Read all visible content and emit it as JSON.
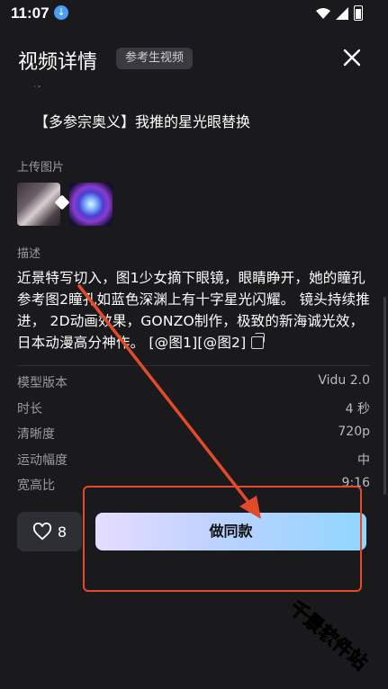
{
  "status": {
    "time": "11:07"
  },
  "header": {
    "title": "视频详情",
    "badge": "参考生视频"
  },
  "prompt": {
    "title": "【多参宗奥义】我推的星光眼替换"
  },
  "uploads": {
    "label": "上传图片"
  },
  "description": {
    "label": "描述",
    "text": "近景特写切入，图1少女摘下眼镜，眼睛睁开，她的瞳孔参考图2瞳孔如蓝色深渊上有十字星光闪耀。 镜头持续推进， 2D动画效果，GONZO制作，极致的新海诚光效，日本动漫高分神作。 [@图1][@图2]"
  },
  "specs": [
    {
      "label": "模型版本",
      "value": "Vidu 2.0"
    },
    {
      "label": "时长",
      "value": "4 秒"
    },
    {
      "label": "清晰度",
      "value": "720p"
    },
    {
      "label": "运动幅度",
      "value": "中"
    },
    {
      "label": "宽高比",
      "value": "9:16"
    }
  ],
  "actions": {
    "like_count": "8",
    "make_same": "做同款"
  },
  "watermark": "千景软件站",
  "icons": [
    "download-icon",
    "wifi-icon",
    "signal-icon",
    "battery-icon",
    "close-icon",
    "copy-icon",
    "heart-icon"
  ],
  "colors": {
    "background": "#1a1a1d",
    "annotation": "#e34a2a",
    "accent_gradient_start": "#e6dcff",
    "accent_gradient_end": "#8fd6ff"
  }
}
